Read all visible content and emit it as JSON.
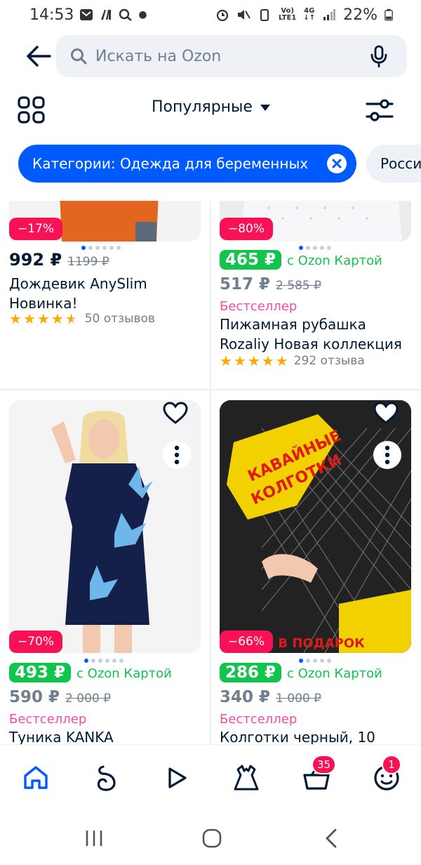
{
  "status_bar": {
    "time": "14:53",
    "battery_percent": "22%",
    "network_top": "Vo)",
    "network_bottom": "LTE1",
    "network_type": "4G"
  },
  "search": {
    "placeholder": "Искать на Ozon"
  },
  "sort": {
    "label": "Популярные"
  },
  "chips": {
    "active_label": "Категории: Одежда для беременных",
    "second_label": "Россия"
  },
  "products": [
    {
      "discount": "−17%",
      "price": "992 ₽",
      "old_price": "1199 ₽",
      "title": "Дождевик AnySlim Новинка!",
      "rating_value": 4.5,
      "reviews": "50 отзывов",
      "image_colors": {
        "main": "#e3661f",
        "bg": "#f2f2f2"
      }
    },
    {
      "discount": "−80%",
      "card_price": "465 ₽",
      "card_label": "с Ozon Картой",
      "price": "517 ₽",
      "old_price": "2 585 ₽",
      "badge": "Бестселлер",
      "title": "Пижамная рубашка Rozaliy Новая коллекция",
      "rating_value": 5,
      "reviews": "292 отзыва",
      "image_colors": {
        "main": "#f4f4f6",
        "bg": "#e9e9ec"
      }
    },
    {
      "discount": "−70%",
      "card_price": "493 ₽",
      "card_label": "с Ozon Картой",
      "price": "590 ₽",
      "old_price": "2 000 ₽",
      "badge": "Бестселлер",
      "title": "Туника KANKA",
      "image_colors": {
        "main": "#15204a",
        "accent": "#6fb6ea",
        "bg": "#f5f5f5"
      }
    },
    {
      "discount": "−66%",
      "card_price": "286 ₽",
      "card_label": "с Ozon Картой",
      "price": "340 ₽",
      "old_price": "1 000 ₽",
      "badge": "Бестселлер",
      "title": "Колготки черный, 10",
      "image_text_1": "КАВАЙНЫЕ",
      "image_text_2": "КОЛГОТКИ",
      "image_text_3": "И В ПОДАРОК",
      "image_colors": {
        "main": "#222222",
        "accent": "#f2d100",
        "text": "#e01a1a"
      }
    }
  ],
  "bottom_nav": {
    "cart_badge": "35",
    "profile_badge": "1"
  },
  "colors": {
    "accent": "#005bff",
    "discount": "#f91155",
    "ozon_card_green": "#10c44c",
    "bestseller": "#f1117e"
  }
}
